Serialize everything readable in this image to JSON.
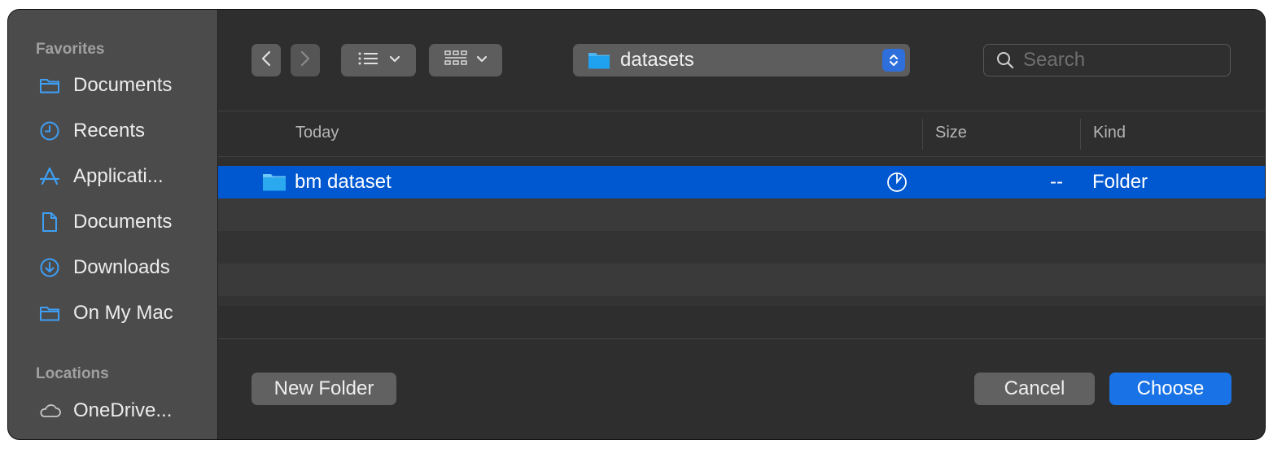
{
  "sidebar": {
    "favorites_header": "Favorites",
    "locations_header": "Locations",
    "items": [
      {
        "label": "Documents",
        "icon": "folder-icon"
      },
      {
        "label": "Recents",
        "icon": "clock-icon"
      },
      {
        "label": "Applicati...",
        "icon": "applications-icon"
      },
      {
        "label": "Documents",
        "icon": "document-icon"
      },
      {
        "label": "Downloads",
        "icon": "download-icon"
      },
      {
        "label": "On My Mac",
        "icon": "folder-icon"
      }
    ],
    "locations": [
      {
        "label": "OneDrive...",
        "icon": "cloud-icon"
      }
    ]
  },
  "toolbar": {
    "path_label": "datasets",
    "search_placeholder": "Search"
  },
  "columns": {
    "name": "Today",
    "size": "Size",
    "kind": "Kind"
  },
  "files": [
    {
      "name": "bm dataset",
      "size": "--",
      "kind": "Folder",
      "selected": true
    }
  ],
  "footer": {
    "new_folder": "New Folder",
    "cancel": "Cancel",
    "choose": "Choose"
  },
  "colors": {
    "accent": "#1a73e6",
    "selection": "#0058d0",
    "sidebar_bg": "#4b4b4b",
    "main_bg": "#2e2e2e",
    "folder_icon": "#4fb5ef"
  }
}
